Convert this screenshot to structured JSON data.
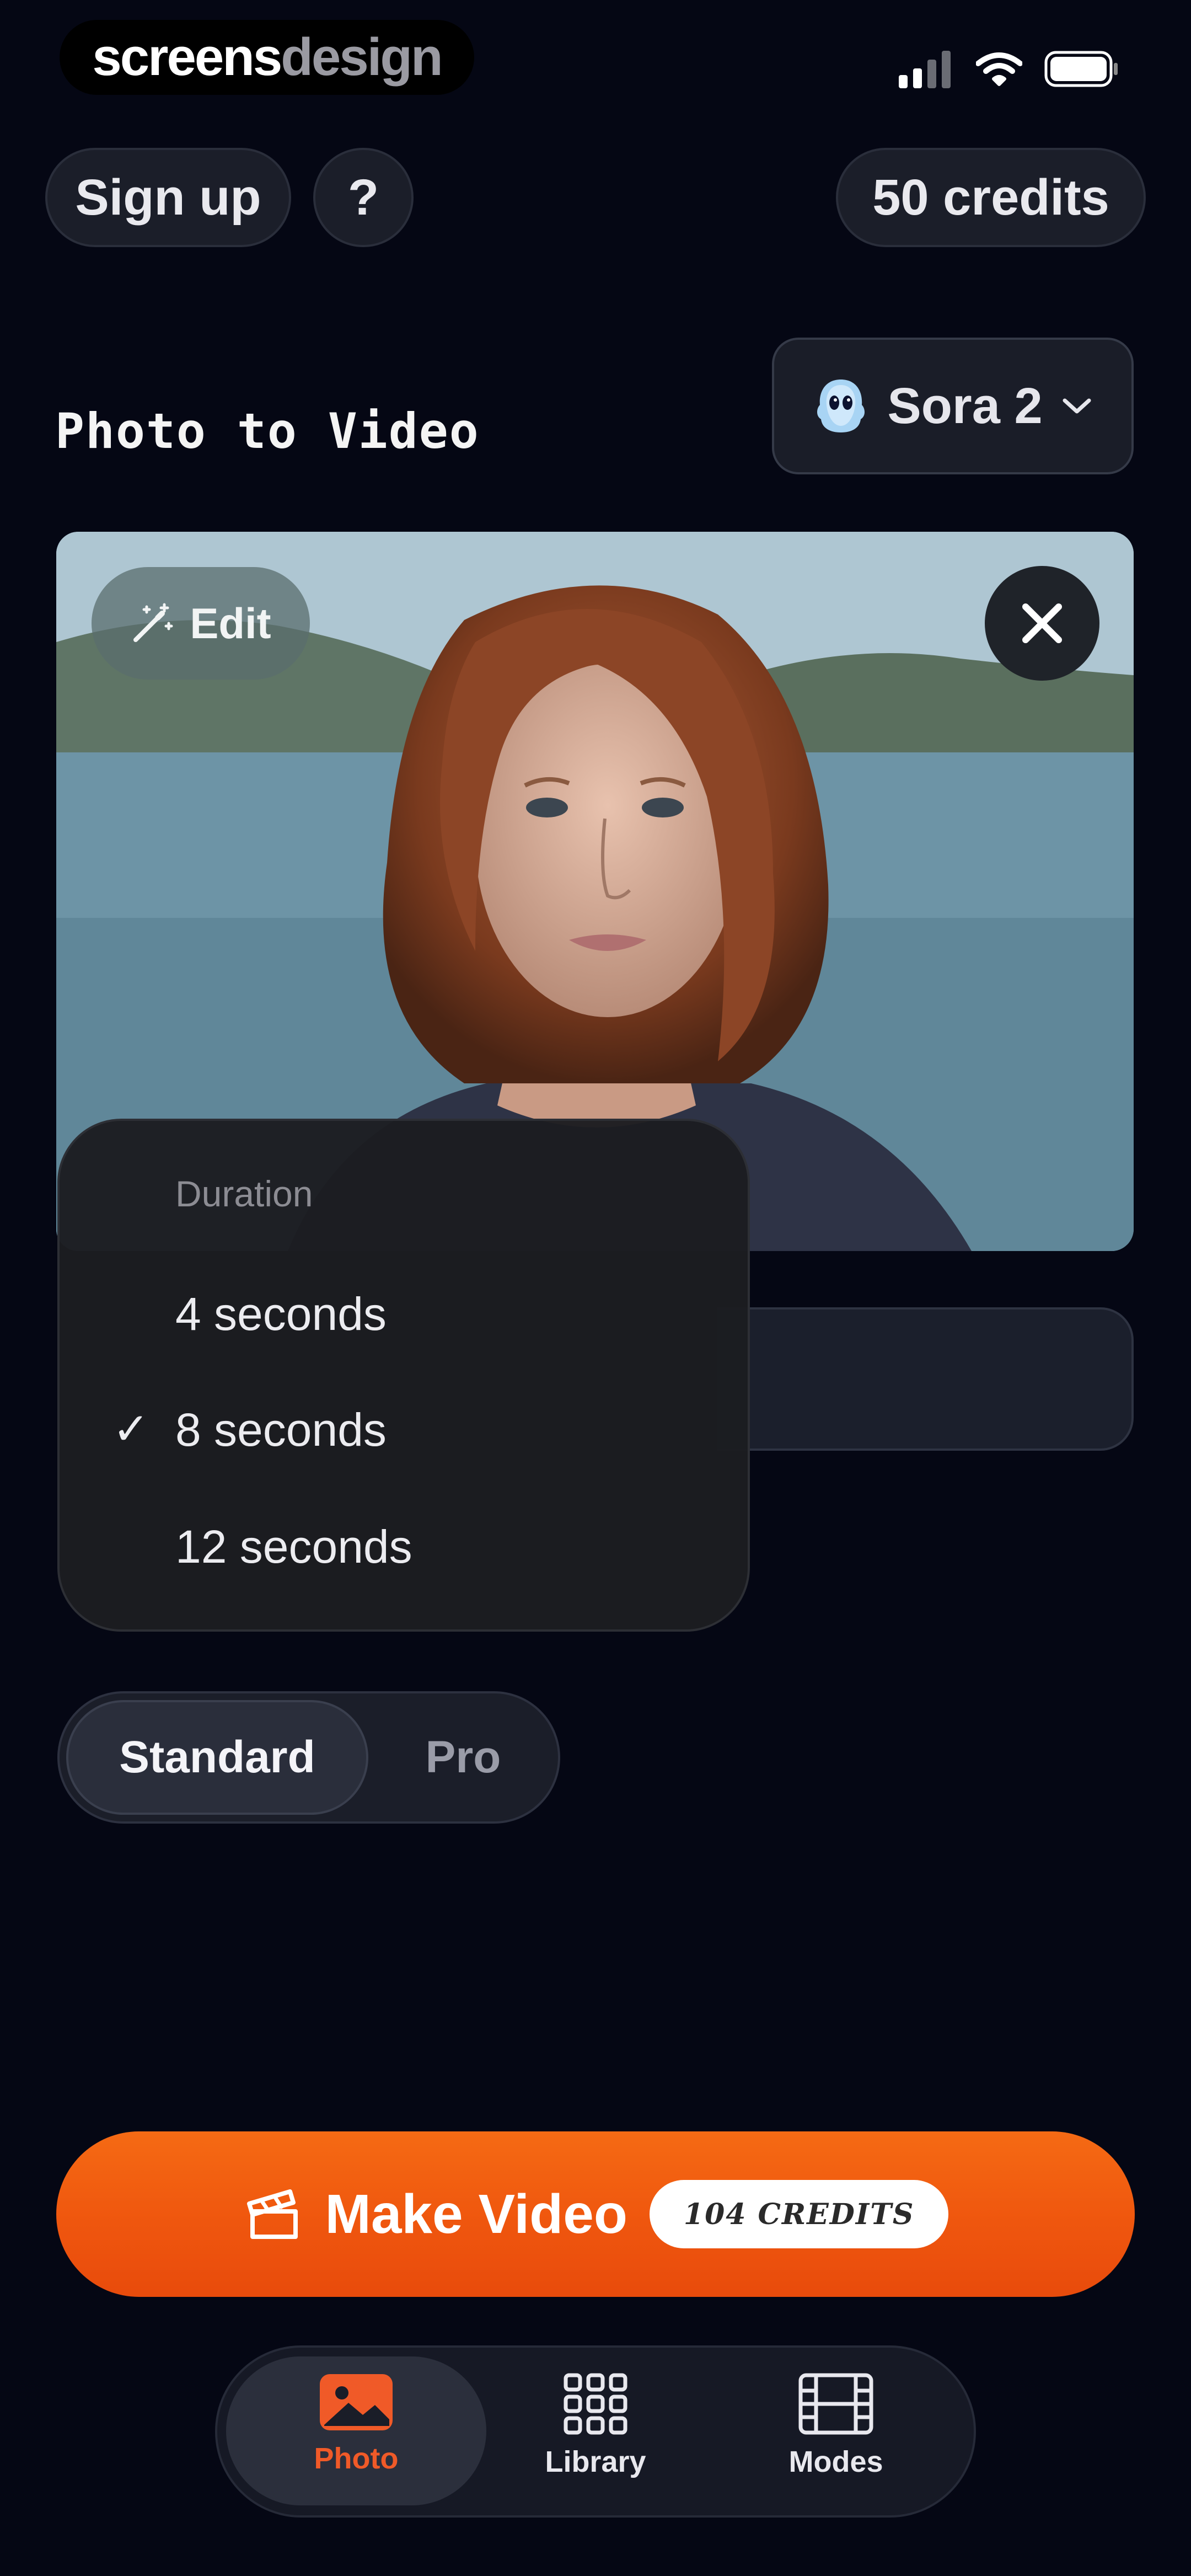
{
  "status_bar": {
    "brand_part1": "screens",
    "brand_part2": "design"
  },
  "header": {
    "signup_label": "Sign up",
    "help_label": "?",
    "credits_label": "50 credits",
    "page_title": "Photo to Video",
    "model_label": "Sora 2"
  },
  "photo": {
    "edit_label": "Edit"
  },
  "duration_menu": {
    "heading": "Duration",
    "options": [
      "4 seconds",
      "8 seconds",
      "12 seconds"
    ],
    "selected": "8 seconds"
  },
  "quality": {
    "options": [
      "Standard",
      "Pro"
    ],
    "selected": "Standard"
  },
  "make_video": {
    "label": "Make Video",
    "cost": "104 CREDITS"
  },
  "tabbar": {
    "tabs": [
      "Photo",
      "Library",
      "Modes"
    ],
    "active": "Photo"
  },
  "colors": {
    "background": "#050714",
    "accent": "#f05a10",
    "tab_active": "#f05a28"
  }
}
